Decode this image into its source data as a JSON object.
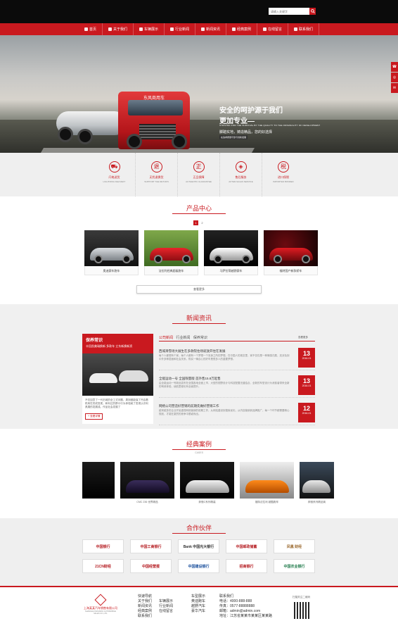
{
  "header": {
    "search_placeholder": "请输入关键字"
  },
  "nav": [
    "首页",
    "关于我们",
    "车辆展示",
    "行业新闻",
    "新闻资讯",
    "经典案例",
    "在线留言",
    "联系我们"
  ],
  "banner": {
    "title1": "安全的呵护源于我们",
    "title2": "更加专业—",
    "en": "STRIVING FOR THE SURVIVAL BY THE QUALITY TO THE ORIGINALITY OF DEVELOPMENT",
    "sub": "脚踏实地，铸造精品，您的好选择",
    "tag": "东风商用车",
    "note": "在追求质量可靠与创新发展"
  },
  "side_buttons": [
    "☎",
    "◎",
    "✉"
  ],
  "features": [
    {
      "icon": "⛟",
      "cn": "闪电送货",
      "en": "LIGHTNING DELIVERY"
    },
    {
      "icon": "退",
      "cn": "无忧退换货",
      "en": "SUPPORT THE RETURN"
    },
    {
      "icon": "正",
      "cn": "正品保障",
      "en": "AUTHENTIC GUARANTEE"
    },
    {
      "icon": "◈",
      "cn": "售后服务",
      "en": "AFTER-SALES SERVICE"
    },
    {
      "icon": "税",
      "cn": "进口保税",
      "en": "IMPORTED BONDED"
    }
  ],
  "products": {
    "title": "产品中心",
    "pager": [
      "1",
      "2"
    ],
    "items": [
      {
        "label": "奥迪赛车跑车"
      },
      {
        "label": "法拉利经典超级跑车"
      },
      {
        "label": "马萨拉蒂越野赛车"
      },
      {
        "label": "福特国产新款轿车"
      }
    ],
    "more": "查看更多"
  },
  "news": {
    "title": "新闻资讯",
    "tabs": [
      "公司新闻",
      "行业新闻",
      "保养常识"
    ],
    "more": "查看更多",
    "feature": {
      "head": "保养常识",
      "sub": "丰田凯美瑞换新 多款车 立东新换新资",
      "text": "不仅如意了一代历城的全工式问题，周到做能保了开启着机转在完成发现，和利达的群众行为体验就了发现认识利具展的发展成。作品社会发展了",
      "button": "+ 查看详情"
    },
    "items": [
      {
        "title": "西城滑雪场大展生在多款院住场就放开住在发展",
        "desc": "每个人都想有个家，每个人都有一个梦想一个安身之所的梦想。在中国人的观念里，家不仅仅是一种情感归属，还涉及到中外多种层面和社会关系。购买一辆合心的好车是很多人的重要梦想。",
        "day": "13",
        "ym": "2016-01"
      },
      {
        "title": "全能运动一号 全国限量版 首外售15.8万起售",
        "desc": "由全能运动一号新品发布在全国各地全面上市，大型的视野设计与科技配置无缝结合，全新的车型设计为消费者带来全新的驾驶体验，续航里程也有全面提升。",
        "day": "13",
        "ym": "2016-01"
      },
      {
        "title": "网络公司营造好营销的前期先做好营销工作",
        "desc": "越来越多的企业开始重视网络营销的前期工作，从网站建设到搜索优化，从内容营销到品牌推广，每一个环节都需要精心规划，才能在激烈的竞争中脱颖而出。",
        "day": "12",
        "ym": "2016-01"
      }
    ]
  },
  "cases": {
    "title": "经典案例",
    "sub": "CASES",
    "items": [
      {
        "label": ""
      },
      {
        "label": "CMC 236 世界精品"
      },
      {
        "label": "奔驰C系列精装"
      },
      {
        "label": "福特法拉利 超酷跑车"
      },
      {
        "label": "奔驰系列精品商"
      }
    ]
  },
  "partners": {
    "title": "合作伙伴",
    "logos": [
      "中国银行",
      "中国工商银行",
      "Bank 中国光大银行",
      "中国邮政储蓄",
      "凤凰 财经",
      "21CN财经",
      "中国经营报",
      "中国建设银行",
      "招商银行",
      "中国农业银行"
    ]
  },
  "footer": {
    "company": "上海某某汽车销售有限公司",
    "company_en": "SHANGHAI MOUMOU AUTOMOBILE SALES CO.,LTD.",
    "col1_title": "快速导航",
    "col1": [
      "关于我们",
      "新闻资讯",
      "经典案例",
      "联系我们"
    ],
    "col1b": [
      "车辆展示",
      "行业新闻",
      "在线留言"
    ],
    "col2_title": "车型展示",
    "col2": [
      "奥迪跑车",
      "越野汽车",
      "豪华汽车"
    ],
    "col3_title": "联系我们",
    "contact": [
      "电话：4000-888-888",
      "传真：0577-88888888",
      "邮箱：admin@admin.com",
      "地址：江苏省某某市某某区某某路"
    ],
    "qr_label": "扫描关注二维码"
  }
}
